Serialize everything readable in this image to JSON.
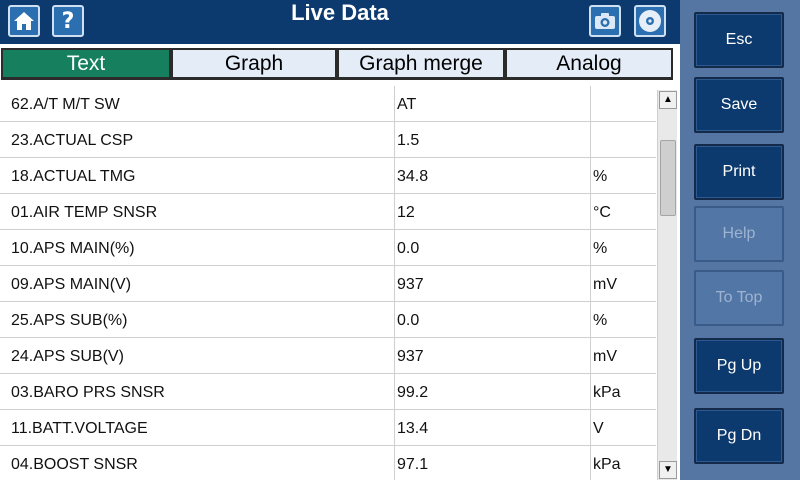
{
  "header": {
    "title": "Live Data",
    "help_glyph": "?",
    "icons": [
      "home-icon",
      "help-icon",
      "camera-icon",
      "disc-icon"
    ]
  },
  "tabs": [
    {
      "label": "Text",
      "active": true
    },
    {
      "label": "Graph",
      "active": false
    },
    {
      "label": "Graph merge",
      "active": false
    },
    {
      "label": "Analog",
      "active": false
    }
  ],
  "rows": [
    {
      "name": "62.A/T M/T SW",
      "value": "AT",
      "unit": ""
    },
    {
      "name": "23.ACTUAL CSP",
      "value": "1.5",
      "unit": ""
    },
    {
      "name": "18.ACTUAL TMG",
      "value": "34.8",
      "unit": "%"
    },
    {
      "name": "01.AIR TEMP SNSR",
      "value": "12",
      "unit": "°C"
    },
    {
      "name": "10.APS MAIN(%)",
      "value": "0.0",
      "unit": "%"
    },
    {
      "name": "09.APS MAIN(V)",
      "value": "937",
      "unit": "mV"
    },
    {
      "name": "25.APS SUB(%)",
      "value": "0.0",
      "unit": "%"
    },
    {
      "name": "24.APS SUB(V)",
      "value": "937",
      "unit": "mV"
    },
    {
      "name": "03.BARO PRS SNSR",
      "value": "99.2",
      "unit": "kPa"
    },
    {
      "name": "11.BATT.VOLTAGE",
      "value": "13.4",
      "unit": "V"
    },
    {
      "name": "04.BOOST SNSR",
      "value": "97.1",
      "unit": "kPa"
    }
  ],
  "scrollbar": {
    "up_glyph": "▲",
    "down_glyph": "▼"
  },
  "side_buttons": [
    {
      "label": "Esc",
      "enabled": true
    },
    {
      "label": "Save",
      "enabled": true
    },
    {
      "label": "Print",
      "enabled": true
    },
    {
      "label": "Help",
      "enabled": false
    },
    {
      "label": "To Top",
      "enabled": false
    },
    {
      "label": "Pg Up",
      "enabled": true
    },
    {
      "label": "Pg Dn",
      "enabled": true
    }
  ],
  "colors": {
    "header_bg": "#0d3a6e",
    "active_tab": "#157f5e",
    "side_panel": "#5576a3",
    "button_bg": "#0d3a6e"
  }
}
